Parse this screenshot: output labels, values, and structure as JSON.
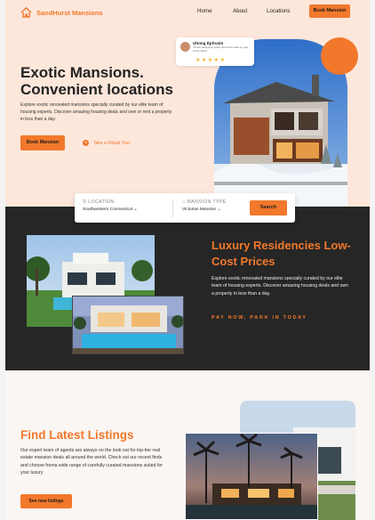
{
  "brand": {
    "name": "SandHurst Mansions",
    "logo_icon": "house-logo-icon",
    "accent": "#f2782b"
  },
  "nav": {
    "home": "Home",
    "about": "About",
    "locations": "Locations",
    "cta": "Book Mansion"
  },
  "review": {
    "name": "Ubong Ephraim",
    "quote": "\"Some awesome quote here that\nmade my day of the week\"",
    "stars": "★★★★★"
  },
  "hero": {
    "title": "Exotic Mansions. Convenient locations",
    "description": "Explore exotic renovated mansions specially curated by our elite team of housing experts. Discover amazing housing deals and own or rent a property in less than a day.",
    "book_label": "Book Mansion",
    "tour_label": "Take a Virtual Tour"
  },
  "search": {
    "location_label": "LOCATION",
    "location_value": "Southwestern Connecticut",
    "type_label": "MANSION TYPE",
    "type_value": "Victorian Mansion",
    "button": "Search"
  },
  "luxury": {
    "title": "Luxury Residencies Low-Cost Prices",
    "description": "Explore exotic renovated mansions specially curated by our elite team of housing experts. Discover amazing housing deals and own a property in less than a day.",
    "tagline": "PAY NOW, PARK IN TODAY"
  },
  "listings": {
    "title": "Find Latest Listings",
    "description": "Our expert team of agents are always on the look out for top-tier real estate mansion deals all around the world. Check out our recent finds and choose froma wide range of carefully curated mansions suited for your luxury",
    "button": "See new listings"
  }
}
